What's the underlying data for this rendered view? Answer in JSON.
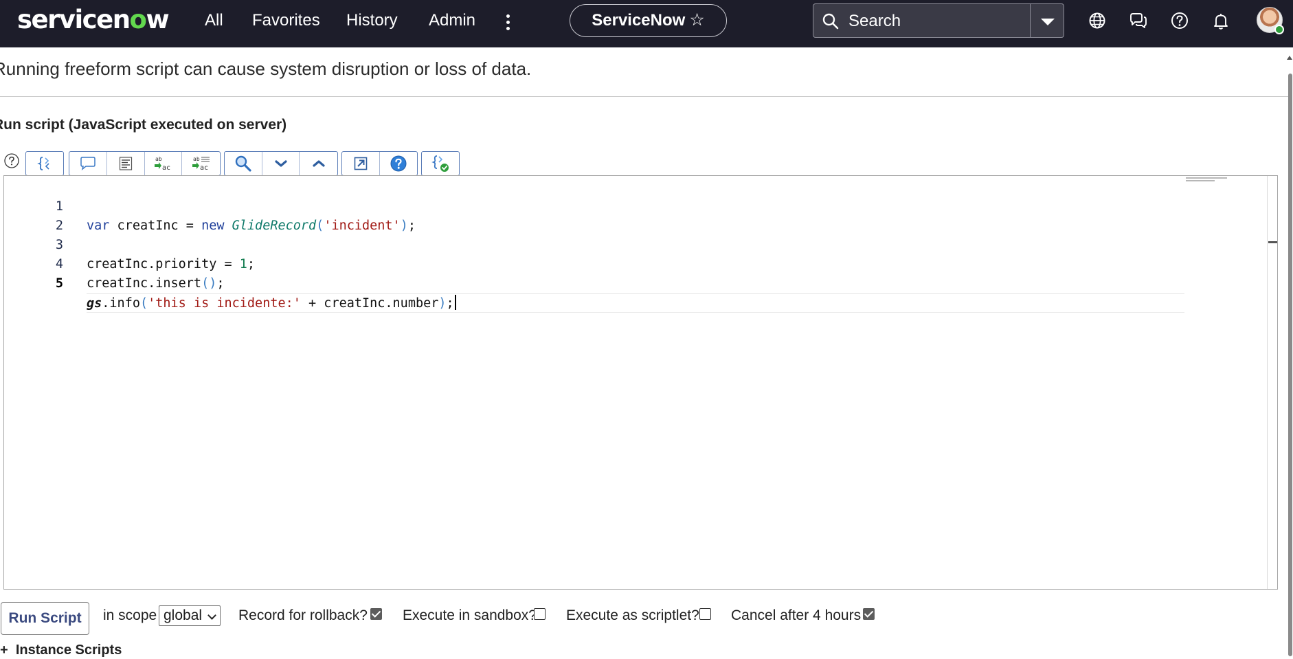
{
  "header": {
    "brand_prefix": "servicen",
    "brand_o": "o",
    "brand_suffix": "w",
    "nav": [
      "All",
      "Favorites",
      "History",
      "Admin"
    ],
    "instance_name": "ServiceNow",
    "search_placeholder": "Search"
  },
  "page": {
    "warning": "Running freeform script can cause system disruption or loss of data.",
    "section_title": "Run script (JavaScript executed on server)"
  },
  "editor": {
    "line_numbers": [
      "1",
      "2",
      "3",
      "4",
      "5"
    ],
    "active_line": 5,
    "code": [
      "var creatInc = new GlideRecord('incident');",
      "",
      "creatInc.priority = 1;",
      "creatInc.insert();",
      "gs.info('this is incidente:' + creatInc.number);"
    ]
  },
  "controls": {
    "run_button": "Run Script",
    "scope_label": "in scope",
    "scope_value": "global",
    "rollback_label": "Record for rollback?",
    "rollback_checked": true,
    "sandbox_label": "Execute in sandbox?",
    "sandbox_checked": false,
    "scriptlet_label": "Execute as scriptlet?",
    "scriptlet_checked": false,
    "cancel_label": "Cancel after 4 hours",
    "cancel_checked": true,
    "instance_scripts_prefix": "+",
    "instance_scripts": "Instance Scripts"
  },
  "colors": {
    "topbar": "#1d1d2a",
    "brand_accent": "#62d84e",
    "toolbar_border": "#5b7db8",
    "keyword": "#1f3f9a",
    "string": "#a11a15",
    "number": "#0e7a4d"
  },
  "icons": {
    "toolbar": [
      "help-icon",
      "format-code-icon",
      "toggle-comment-icon",
      "format-document-icon",
      "replace-icon",
      "replace-all-icon",
      "search-icon",
      "find-next-icon",
      "find-previous-icon",
      "fullscreen-icon",
      "script-help-icon",
      "syntax-check-icon"
    ],
    "header": [
      "globe-icon",
      "chat-icon",
      "help-icon",
      "bell-icon",
      "avatar"
    ]
  }
}
